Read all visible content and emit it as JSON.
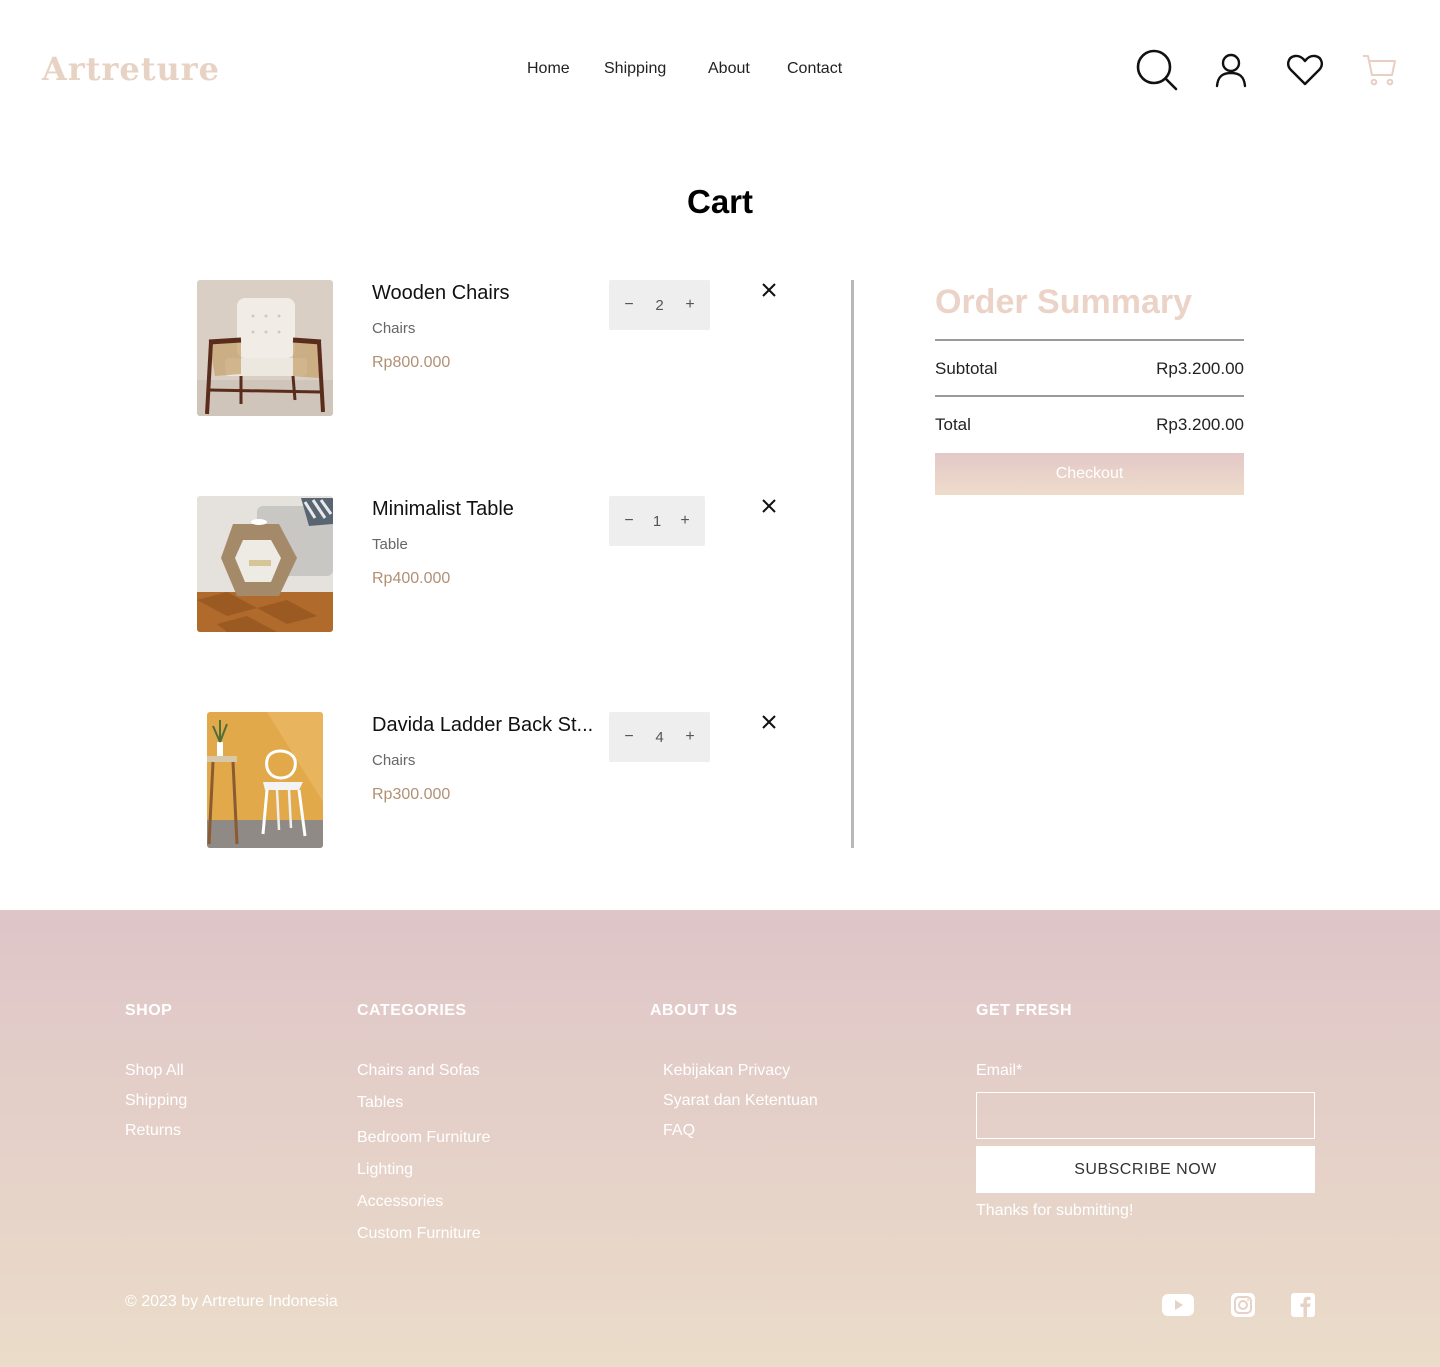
{
  "header": {
    "logo": "Artreture",
    "nav": [
      "Home",
      "Shipping",
      "About",
      "Contact"
    ],
    "icons": [
      "search-icon",
      "user-icon",
      "heart-icon",
      "cart-icon"
    ]
  },
  "cart": {
    "title": "Cart",
    "items": [
      {
        "name": "Wooden Chairs",
        "category": "Chairs",
        "price": "Rp800.000",
        "qty": "2",
        "image": "armchair-photo"
      },
      {
        "name": "Minimalist Table",
        "category": "Table",
        "price": "Rp400.000",
        "qty": "1",
        "image": "side-table-photo"
      },
      {
        "name": "Davida Ladder Back St...",
        "category": "Chairs",
        "price": "Rp300.000",
        "qty": "4",
        "image": "white-chair-photo"
      }
    ],
    "minus": "−",
    "plus": "+"
  },
  "summary": {
    "title": "Order Summary",
    "subtotal_label": "Subtotal",
    "subtotal_value": "Rp3.200.00",
    "total_label": "Total",
    "total_value": "Rp3.200.00",
    "checkout": "Checkout"
  },
  "footer": {
    "shop": {
      "heading": "SHOP",
      "links": [
        "Shop All",
        "Shipping",
        "Returns"
      ]
    },
    "categories": {
      "heading": "CATEGORIES",
      "links": [
        "Chairs and Sofas",
        "Tables",
        "Bedroom Furniture",
        "Lighting",
        "Accessories",
        "Custom Furniture"
      ]
    },
    "about": {
      "heading": "ABOUT US",
      "links": [
        "Kebijakan Privacy",
        "Syarat dan Ketentuan",
        "FAQ"
      ]
    },
    "fresh": {
      "heading": "GET FRESH",
      "email_label": "Email*",
      "email_value": "",
      "subscribe": "SUBSCRIBE NOW",
      "thanks": "Thanks for submitting!"
    },
    "copyright": "© 2023 by Artreture Indonesia",
    "social": [
      "youtube-icon",
      "instagram-icon",
      "facebook-icon"
    ]
  },
  "colors": {
    "logo": "#e8d2c4",
    "price": "#b29074",
    "summary_title": "#ebd3c7",
    "footer_top": "#dec5c8",
    "footer_bottom": "#ebdcc9"
  }
}
